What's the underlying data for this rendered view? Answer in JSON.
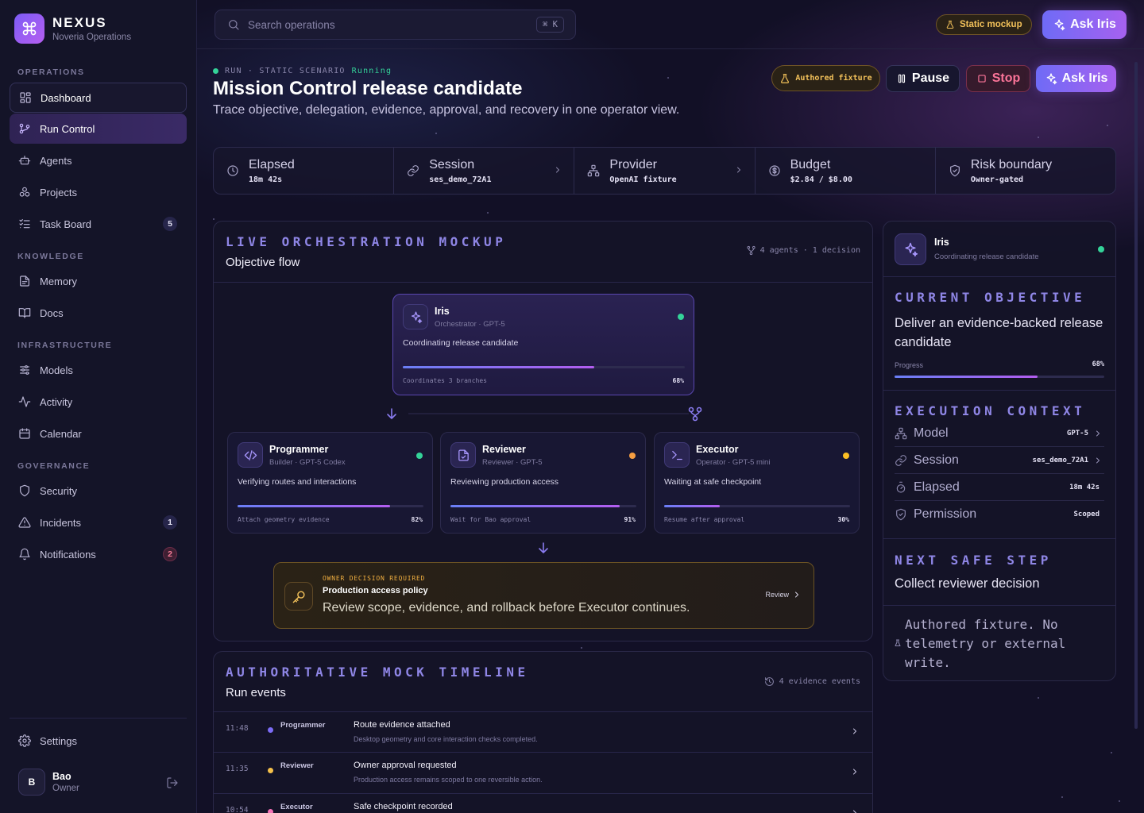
{
  "app": {
    "name": "NEXUS",
    "org": "Noveria Operations"
  },
  "sidebar": {
    "sections": [
      {
        "label": "OPERATIONS",
        "items": [
          {
            "label": "Dashboard",
            "icon": "dashboard-icon"
          },
          {
            "label": "Run Control",
            "icon": "run-control-icon"
          },
          {
            "label": "Agents",
            "icon": "agents-icon"
          },
          {
            "label": "Projects",
            "icon": "projects-icon"
          },
          {
            "label": "Task Board",
            "icon": "task-board-icon",
            "badge": "5"
          }
        ]
      },
      {
        "label": "KNOWLEDGE",
        "items": [
          {
            "label": "Memory",
            "icon": "memory-icon"
          },
          {
            "label": "Docs",
            "icon": "docs-icon"
          }
        ]
      },
      {
        "label": "INFRASTRUCTURE",
        "items": [
          {
            "label": "Models",
            "icon": "models-icon"
          },
          {
            "label": "Activity",
            "icon": "activity-icon"
          },
          {
            "label": "Calendar",
            "icon": "calendar-icon"
          }
        ]
      },
      {
        "label": "GOVERNANCE",
        "items": [
          {
            "label": "Security",
            "icon": "shield-icon"
          },
          {
            "label": "Incidents",
            "icon": "warning-icon",
            "badge": "1"
          },
          {
            "label": "Notifications",
            "icon": "bell-icon",
            "badge": "2"
          }
        ]
      }
    ],
    "settings": "Settings",
    "user": {
      "initial": "B",
      "name": "Bao",
      "role": "Owner"
    }
  },
  "topbar": {
    "search_placeholder": "Search operations",
    "shortcut": "⌘ K",
    "static_pill": "Static mockup",
    "ask_iris": "Ask Iris"
  },
  "header": {
    "run_label": "RUN · STATIC SCENARIO",
    "status": "Running",
    "title": "Mission Control release candidate",
    "subtitle": "Trace objective, delegation, evidence, approval, and recovery in one operator view.",
    "fixture_pill": "Authored fixture",
    "pause": "Pause",
    "stop": "Stop",
    "ask_iris": "Ask Iris"
  },
  "stats": [
    {
      "label": "Elapsed",
      "value": "18m 42s",
      "icon": "clock-icon"
    },
    {
      "label": "Session",
      "value": "ses_demo_72A1",
      "icon": "link-icon"
    },
    {
      "label": "Provider",
      "value": "OpenAI fixture",
      "icon": "network-icon"
    },
    {
      "label": "Budget",
      "value": "$2.84 / $8.00",
      "icon": "dollar-icon"
    },
    {
      "label": "Risk boundary",
      "value": "Owner-gated",
      "icon": "shield-check-icon"
    }
  ],
  "orchestration": {
    "title": "LIVE ORCHESTRATION MOCKUP",
    "subtitle": "Objective flow",
    "meta": "4 agents · 1 decision",
    "orchestrator": {
      "name": "Iris",
      "role": "Orchestrator · GPT-5",
      "desc": "Coordinating release candidate",
      "foot": "Coordinates 3 branches",
      "pct": "68%",
      "progress": 0.68
    },
    "agents": [
      {
        "name": "Programmer",
        "role": "Builder · GPT-5 Codex",
        "desc": "Verifying routes and interactions",
        "foot": "Attach geometry evidence",
        "pct": "82%",
        "progress": 0.82,
        "status_color": "#34d399"
      },
      {
        "name": "Reviewer",
        "role": "Reviewer · GPT-5",
        "desc": "Reviewing production access",
        "foot": "Wait for Bao approval",
        "pct": "91%",
        "progress": 0.91,
        "status_color": "#f59e42"
      },
      {
        "name": "Executor",
        "role": "Operator · GPT-5 mini",
        "desc": "Waiting at safe checkpoint",
        "foot": "Resume after approval",
        "pct": "30%",
        "progress": 0.3,
        "status_color": "#fbbf24"
      }
    ],
    "decision": {
      "tag": "OWNER DECISION REQUIRED",
      "title": "Production access policy",
      "desc": "Review scope, evidence, and rollback before Executor continues.",
      "action": "Review"
    }
  },
  "timeline": {
    "title": "AUTHORITATIVE MOCK TIMELINE",
    "subtitle": "Run events",
    "meta": "4 evidence events",
    "events": [
      {
        "time": "11:48",
        "who": "Programmer",
        "event": "Route evidence attached",
        "desc": "Desktop geometry and core interaction checks completed.",
        "color": "#7c6cf6"
      },
      {
        "time": "11:35",
        "who": "Reviewer",
        "event": "Owner approval requested",
        "desc": "Production access remains scoped to one reversible action.",
        "color": "#f5c04a"
      },
      {
        "time": "10:54",
        "who": "Executor",
        "event": "Safe checkpoint recorded",
        "desc": "",
        "color": "#f472b6"
      }
    ]
  },
  "side": {
    "agent": {
      "name": "Iris",
      "desc": "Coordinating release candidate"
    },
    "objective": {
      "title": "CURRENT OBJECTIVE",
      "text": "Deliver an evidence-backed release candidate",
      "progress_label": "Progress",
      "pct": "68%",
      "progress": 0.68
    },
    "context": {
      "title": "EXECUTION CONTEXT",
      "rows": [
        {
          "label": "Model",
          "value": "GPT-5",
          "icon": "network-icon",
          "chevron": true
        },
        {
          "label": "Session",
          "value": "ses_demo_72A1",
          "icon": "link-icon",
          "chevron": true
        },
        {
          "label": "Elapsed",
          "value": "18m 42s",
          "icon": "timer-icon",
          "chevron": false
        },
        {
          "label": "Permission",
          "value": "Scoped",
          "icon": "shield-check-icon",
          "chevron": false
        }
      ]
    },
    "next": {
      "title": "NEXT SAFE STEP",
      "text": "Collect reviewer decision"
    },
    "note": "Authored fixture. No telemetry or external write."
  }
}
